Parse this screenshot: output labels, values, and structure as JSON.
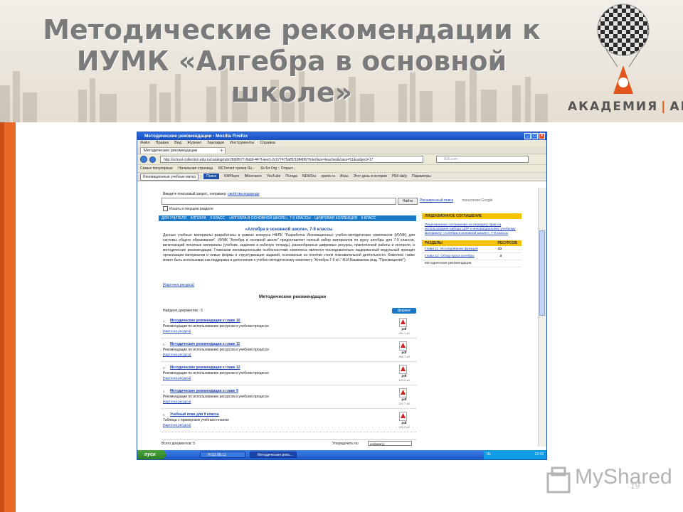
{
  "slide": {
    "title_line1": "Методические рекомендации к",
    "title_line2": "ИУМК «Алгебра в основной школе»",
    "logo_text_left": "АКАДЕМИЯ",
    "logo_text_right": "АЙТИ",
    "page_number": "19",
    "watermark": "MyShared",
    "colors": {
      "accent": "#e8692a",
      "title": "#7a7a7a"
    }
  },
  "browser": {
    "window_title": "Методические рекомендации - Mozilla Firefox",
    "menu": [
      "Файл",
      "Правка",
      "Вид",
      "Журнал",
      "Закладки",
      "Инструменты",
      "Справка"
    ],
    "tab_label": "Методические рекомендации",
    "new_tab": "+",
    "url": "http://school-collection.edu.ru/catalog/rubr/3fd0fb77-8ab9-447f-aee1-2c077475aff2/108406/?interface=teacher&class=51&subject=17",
    "search_placeholder": "Ask.com",
    "bookmarks": [
      "Самые популярные",
      "Начальная страница",
      "BKTorrent трекер Ru...",
      "RuTor.Org :: Открыт..."
    ],
    "toolbar": {
      "select_value": "Инновационные учебные матер",
      "search_btn": "Поиск",
      "items": [
        "KMPlayer",
        "ВКонтакте",
        "YouTube",
        "Погода",
        "NEWSru",
        "sports.ru",
        "Игры",
        "Этот день в истории",
        "РБК daily",
        "Параметры"
      ]
    }
  },
  "page": {
    "search_prompt": "Введите поисковый запрос, например:",
    "search_example": "свойства водорода",
    "find_btn": "Найти",
    "advanced_search": "Расширенный поиск",
    "google_tag": "технология Google",
    "checkbox_label": "Искать в текущем разделе",
    "breadcrumb": [
      "ДЛЯ УЧИТЕЛЯ",
      "АЛГЕБРА",
      "9 КЛАСС",
      "«АЛГЕБРА В ОСНОВНОЙ ШКОЛЕ», 7-9 КЛАССЫ",
      "ЦИФРОВАЯ КОЛЛЕКЦИЯ",
      "9 КЛАСС"
    ],
    "main_title": "«Алгебра в основной школе», 7-9 классы",
    "description": "Данные учебные материалы разработаны в рамках конкурса НФПК \"Разработка Инновационных учебно-методических комплексов (ИУМК) для системы общего образования\". ИУМК \"Алгебра в основной школе\" предоставляет полный набор материалов по курсу алгебры для 7-9 классов, включающий печатные материалы (учебник, задачник и рабочую тетрадь), разнообразные цифровые ресурсы, практической работы и контроля, и методические рекомендации. Главными инновационными особенностями комплекса является последовательно выдержанный модульный принцип организации материалов и новые формы и структуризация заданий, основанные на понятии стиля познавательной деятельности. Комплекс также может быть использован как поддержка и дополнение к учебно-методическому комплекту \"Алгебра 7-9 кл.\" М.И.Башмакова (изд. \"Просвещение\").",
    "card_link": "[Карточка ресурса]",
    "section_title": "Методические рекомендации",
    "found_count": "Найдено документов - 5",
    "format_badge": "формат",
    "documents": [
      {
        "num": "1",
        "title": "Методические рекомендации к главе 10",
        "desc": "Рекомендации по использованию ресурсов в учебном процессе",
        "card": "[Карточка ресурса]",
        "format": "pdf",
        "size": "261.1 кб"
      },
      {
        "num": "2",
        "title": "Методические рекомендации к главе 11",
        "desc": "Рекомендации по использованию ресурсов в учебном процессе",
        "card": "[Карточка ресурса]",
        "format": "pdf",
        "size": "392.7 кб"
      },
      {
        "num": "3",
        "title": "Методические рекомендации к главе 12",
        "desc": "Рекомендации по использованию ресурсов в учебном процессе",
        "card": "[Карточка ресурса]",
        "format": "pdf",
        "size": "429.0 кб"
      },
      {
        "num": "4",
        "title": "Методические рекомендации к главе 9",
        "desc": "Рекомендации по использованию ресурсов в учебном процессе",
        "card": "[Карточка ресурса]",
        "format": "pdf",
        "size": "257.7 кб"
      },
      {
        "num": "5",
        "title": "Учебный план для 9 класса",
        "desc": "Таблица с примерным учебным планом",
        "card": "[Карточка ресурса]",
        "format": "pdf",
        "size": "103.2 кб"
      }
    ],
    "footer_total": "Всего документов: 5",
    "sort_label": "Упорядочить по",
    "sort_value": "алфавиту",
    "sidebar": {
      "license_head": "ЛИЦЕНЗИОННОЕ СОГЛАШЕНИЕ",
      "license_text": "Лицензионное соглашение на передачу прав на использование набора ЦОР к инновационному учебному материалу «Алгебра в основной школе», 7-9 классы",
      "sections_head": "РАЗДЕЛЫ",
      "resources_head": "РЕСУРСОВ",
      "rows": [
        {
          "label": "Глава 11. Исследование функций",
          "count": "43"
        },
        {
          "label": "Глава 12. Обзор курса алгебры",
          "count": "3"
        },
        {
          "label": "Методические рекомендации",
          "count": ""
        }
      ]
    }
  },
  "taskbar": {
    "start": "пуск",
    "items": [
      "H:\\23.08.11",
      "Методические реко..."
    ],
    "lang": "RL",
    "clock": "12:43"
  }
}
